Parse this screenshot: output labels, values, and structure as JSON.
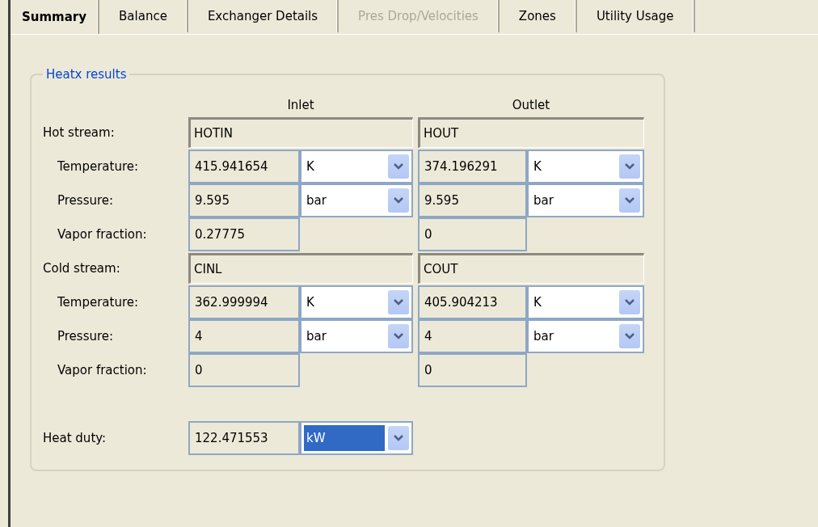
{
  "tabs": [
    {
      "label": "Summary",
      "selected": true,
      "disabled": false
    },
    {
      "label": "Balance",
      "selected": false,
      "disabled": false
    },
    {
      "label": "Exchanger Details",
      "selected": false,
      "disabled": false
    },
    {
      "label": "Pres Drop/Velocities",
      "selected": false,
      "disabled": true
    },
    {
      "label": "Zones",
      "selected": false,
      "disabled": false
    },
    {
      "label": "Utility Usage",
      "selected": false,
      "disabled": false
    }
  ],
  "group": {
    "title": "Heatx results",
    "columns": [
      "Inlet",
      "Outlet"
    ],
    "rows": [
      {
        "kind": "stream",
        "label": "Hot stream:",
        "inlet": {
          "value": "HOTIN"
        },
        "outlet": {
          "value": "HOUT"
        }
      },
      {
        "kind": "quantity",
        "label": "Temperature:",
        "inlet": {
          "value": "415.941654",
          "unit": "K"
        },
        "outlet": {
          "value": "374.196291",
          "unit": "K"
        }
      },
      {
        "kind": "quantity",
        "label": "Pressure:",
        "inlet": {
          "value": "9.595",
          "unit": "bar"
        },
        "outlet": {
          "value": "9.595",
          "unit": "bar"
        }
      },
      {
        "kind": "quantity",
        "label": "Vapor fraction:",
        "inlet": {
          "value": "0.27775"
        },
        "outlet": {
          "value": "0"
        }
      },
      {
        "kind": "stream",
        "label": "Cold stream:",
        "inlet": {
          "value": "CINL"
        },
        "outlet": {
          "value": "COUT"
        }
      },
      {
        "kind": "quantity",
        "label": "Temperature:",
        "inlet": {
          "value": "362.999994",
          "unit": "K"
        },
        "outlet": {
          "value": "405.904213",
          "unit": "K"
        }
      },
      {
        "kind": "quantity",
        "label": "Pressure:",
        "inlet": {
          "value": "4",
          "unit": "bar"
        },
        "outlet": {
          "value": "4",
          "unit": "bar"
        }
      },
      {
        "kind": "quantity",
        "label": "Vapor fraction:",
        "inlet": {
          "value": "0"
        },
        "outlet": {
          "value": "0"
        }
      }
    ],
    "heat_duty": {
      "label": "Heat duty:",
      "value": "122.471553",
      "unit": "kW",
      "unit_highlighted": true
    }
  }
}
